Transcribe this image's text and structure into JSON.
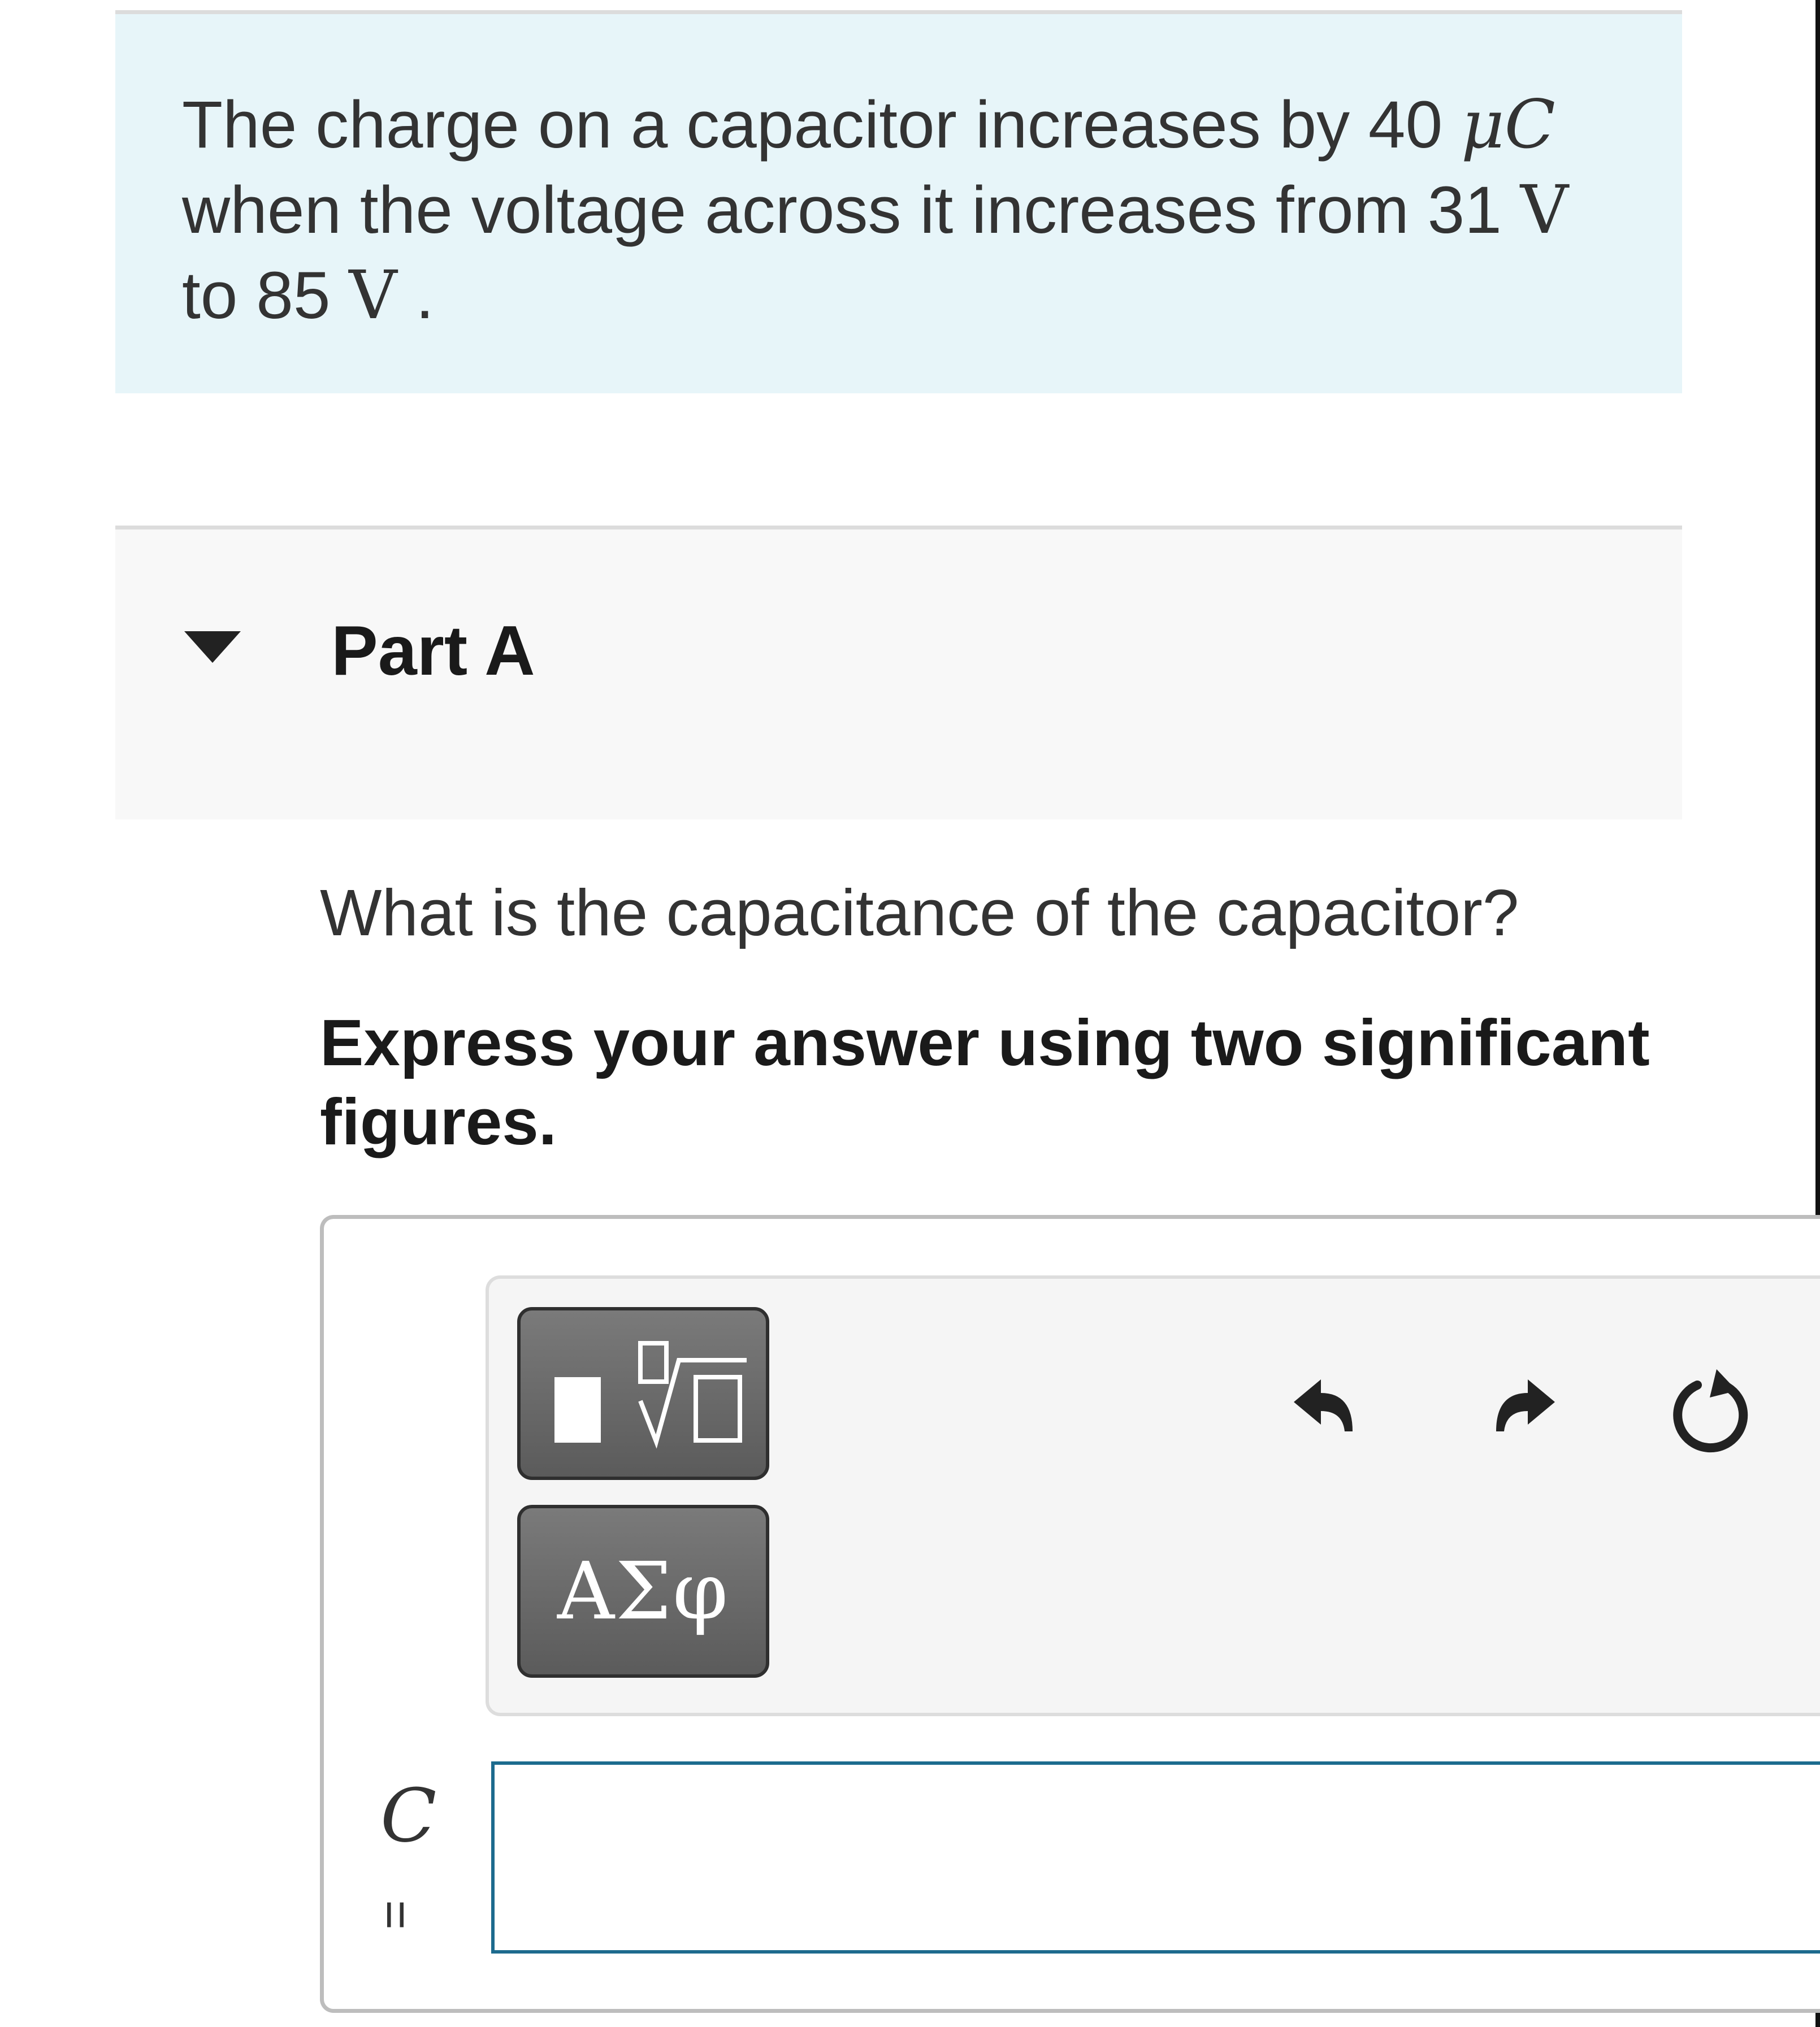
{
  "problem": {
    "text_part1": "The charge on a capacitor increases by 40 ",
    "unit_charge": "μC",
    "text_part2": "when the voltage across it increases from 31 ",
    "unit_v1": "V",
    "text_part3": "to 85 ",
    "unit_v2": "V",
    "text_end": " ."
  },
  "part": {
    "title": "Part A",
    "expanded": true
  },
  "question": {
    "text": "What is the capacitance of the capacitor?",
    "instruction": "Express your answer using two significant figures."
  },
  "toolbar": {
    "templates_icon": "templates-sqrt-icon",
    "greek_label": "ΑΣφ",
    "undo_icon": "undo-icon",
    "redo_icon": "redo-icon",
    "reset_icon": "reset-icon"
  },
  "answer": {
    "variable": "C",
    "equals": "=",
    "value": "",
    "input_border_color": "#1d6b8e"
  }
}
